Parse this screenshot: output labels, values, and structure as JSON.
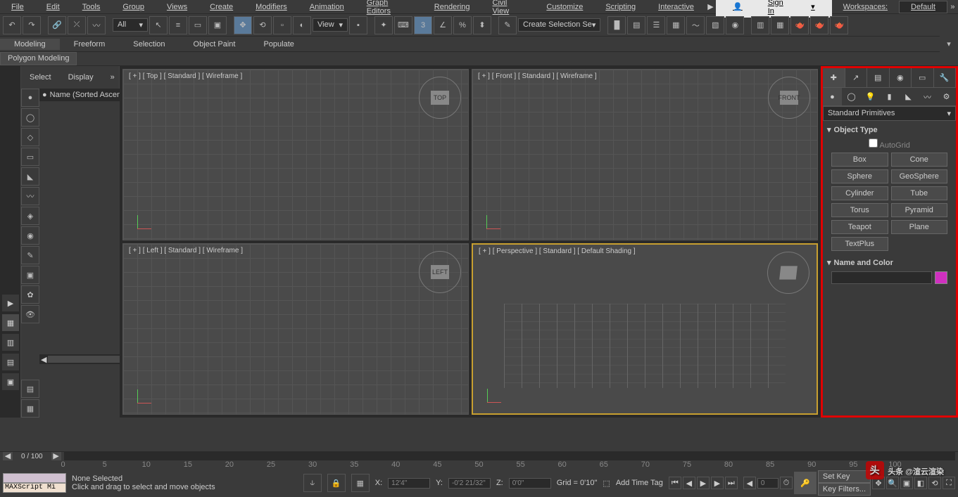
{
  "menubar": {
    "items": [
      "File",
      "Edit",
      "Tools",
      "Group",
      "Views",
      "Create",
      "Modifiers",
      "Animation",
      "Graph Editors",
      "Rendering",
      "Civil View",
      "Customize",
      "Scripting",
      "Interactive"
    ],
    "signin": "Sign In",
    "workspaces_label": "Workspaces:",
    "workspace": "Default"
  },
  "toolbar": {
    "filter": "All",
    "view": "View",
    "selection_set": "Create Selection Se"
  },
  "ribbon": {
    "tabs": [
      "Modeling",
      "Freeform",
      "Selection",
      "Object Paint",
      "Populate"
    ],
    "active": 0,
    "sub": "Polygon Modeling"
  },
  "left_panel": {
    "tabs": [
      "Select",
      "Display"
    ],
    "header": "Name (Sorted Ascend"
  },
  "viewports": [
    {
      "label": "[ + ] [ Top ] [ Standard ] [ Wireframe ]",
      "cube": "TOP"
    },
    {
      "label": "[ + ] [ Front ] [ Standard ] [ Wireframe ]",
      "cube": "FRONT"
    },
    {
      "label": "[ + ] [ Left ] [ Standard ] [ Wireframe ]",
      "cube": "LEFT"
    },
    {
      "label": "[ + ] [ Perspective ] [ Standard ] [ Default Shading ]",
      "cube": ""
    }
  ],
  "command_panel": {
    "dropdown": "Standard Primitives",
    "rollout1": "Object Type",
    "autogrid": "AutoGrid",
    "buttons": [
      "Box",
      "Cone",
      "Sphere",
      "GeoSphere",
      "Cylinder",
      "Tube",
      "Torus",
      "Pyramid",
      "Teapot",
      "Plane",
      "TextPlus",
      ""
    ],
    "rollout2": "Name and Color"
  },
  "status": {
    "frame": "0 / 100",
    "ticks": [
      "0",
      "5",
      "10",
      "15",
      "20",
      "25",
      "30",
      "35",
      "40",
      "45",
      "50",
      "55",
      "60",
      "65",
      "70",
      "75",
      "80",
      "85",
      "90",
      "95",
      "100"
    ],
    "none_selected": "None Selected",
    "hint": "Click and drag to select and move objects",
    "maxscript": "MAXScript Mi",
    "x_label": "X:",
    "x_val": "12'4\"",
    "y_label": "Y:",
    "y_val": "-0'2 21/32\"",
    "z_label": "Z:",
    "z_val": "0'0\"",
    "grid": "Grid = 0'10\"",
    "add_time_tag": "Add Time Tag",
    "spinner": "0",
    "set_key": "Set Key",
    "key_filters": "Key Filters...",
    "auto": ""
  },
  "watermark": "头条 @渲云渲染"
}
